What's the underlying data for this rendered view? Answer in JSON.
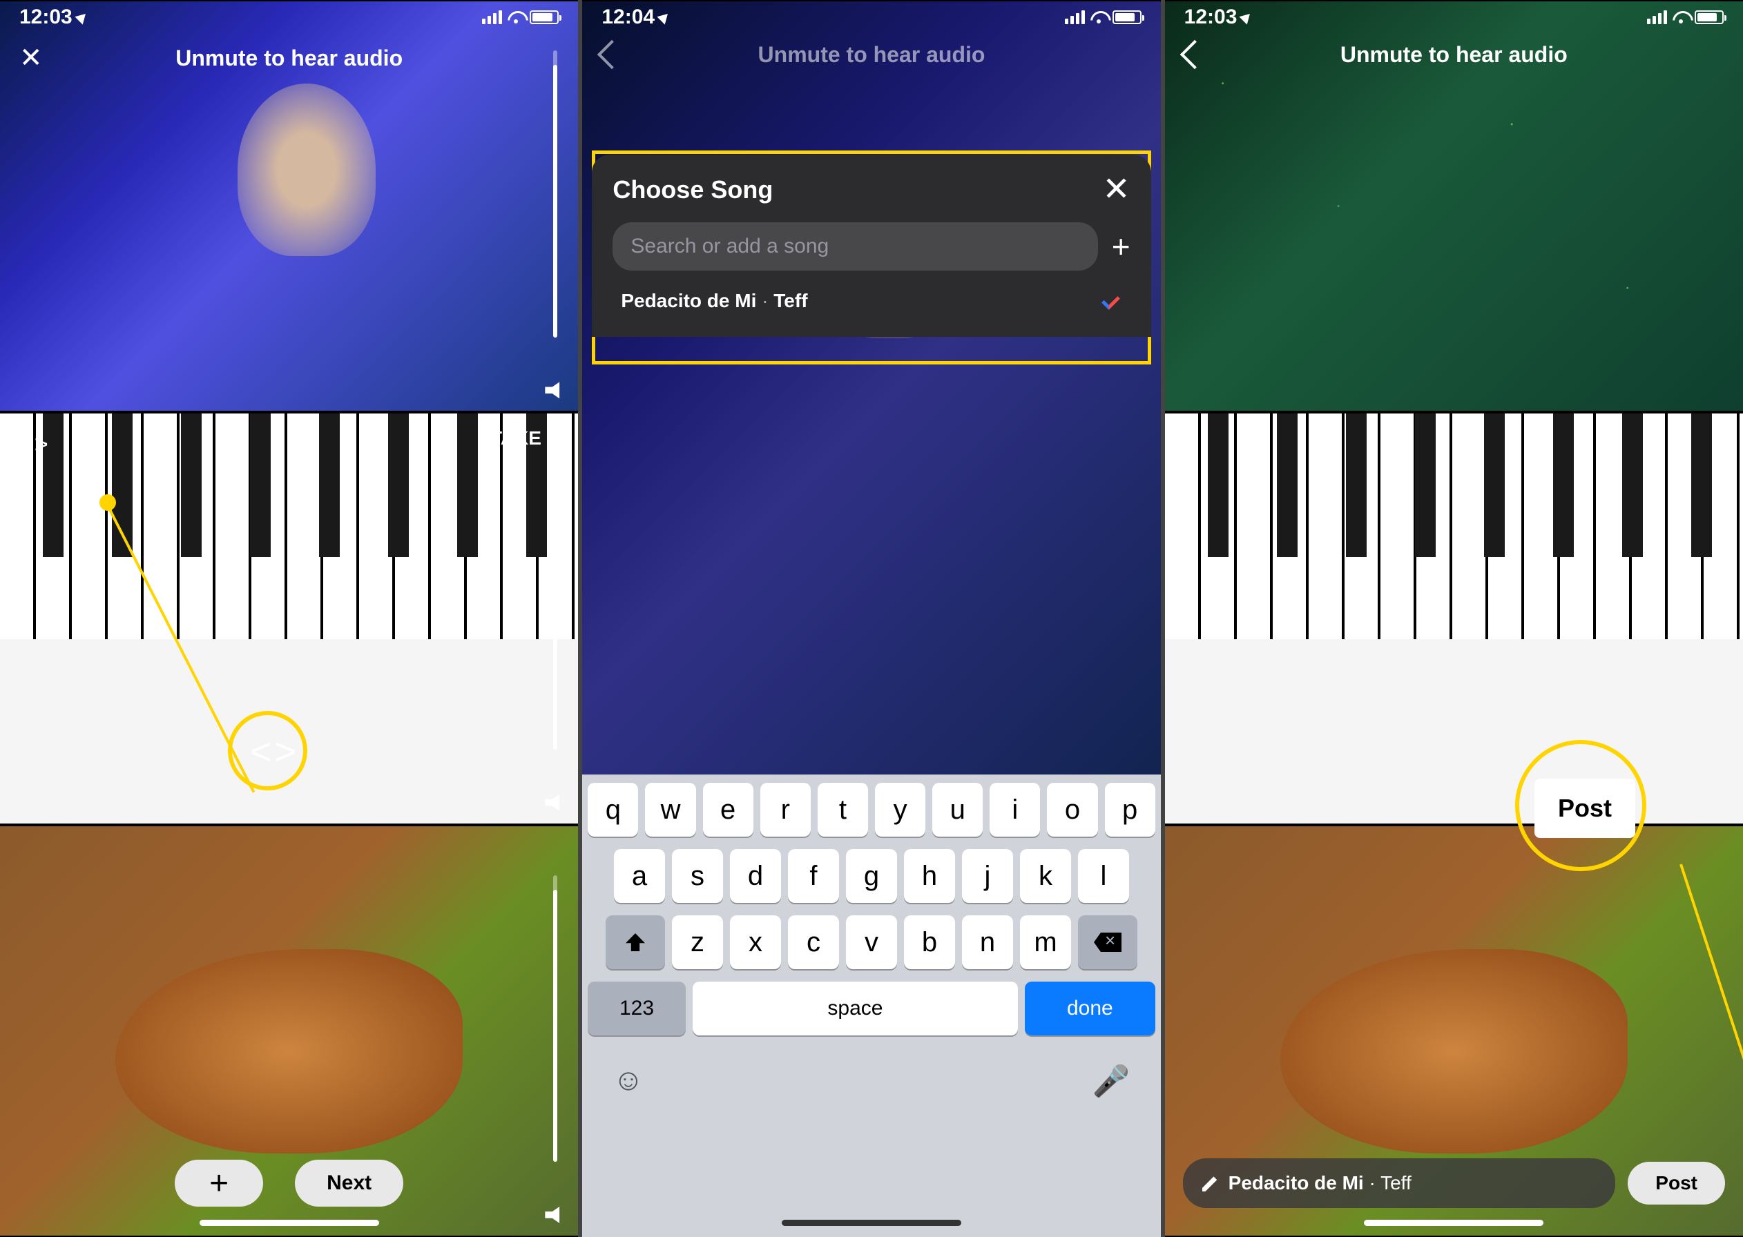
{
  "screens": {
    "left": {
      "status_time": "12:03",
      "title": "Unmute to hear audio",
      "take_label": "TAKE 1",
      "swap_glyph": "< >",
      "plus_label": "+",
      "next_label": "Next"
    },
    "middle": {
      "status_time": "12:04",
      "title": "Unmute to hear audio",
      "modal_title": "Choose Song",
      "search_placeholder": "Search or add a song",
      "song_name": "Pedacito de Mi",
      "song_sep": " · ",
      "song_artist": "Teff",
      "keyboard": {
        "row1": [
          "q",
          "w",
          "e",
          "r",
          "t",
          "y",
          "u",
          "i",
          "o",
          "p"
        ],
        "row2": [
          "a",
          "s",
          "d",
          "f",
          "g",
          "h",
          "j",
          "k",
          "l"
        ],
        "row3": [
          "z",
          "x",
          "c",
          "v",
          "b",
          "n",
          "m"
        ],
        "num": "123",
        "space": "space",
        "done": "done"
      }
    },
    "right": {
      "status_time": "12:03",
      "title": "Unmute to hear audio",
      "song_name": "Pedacito de Mi",
      "song_sep": " · ",
      "song_artist": "Teff",
      "post_label": "Post",
      "post_badge": "Post"
    }
  }
}
